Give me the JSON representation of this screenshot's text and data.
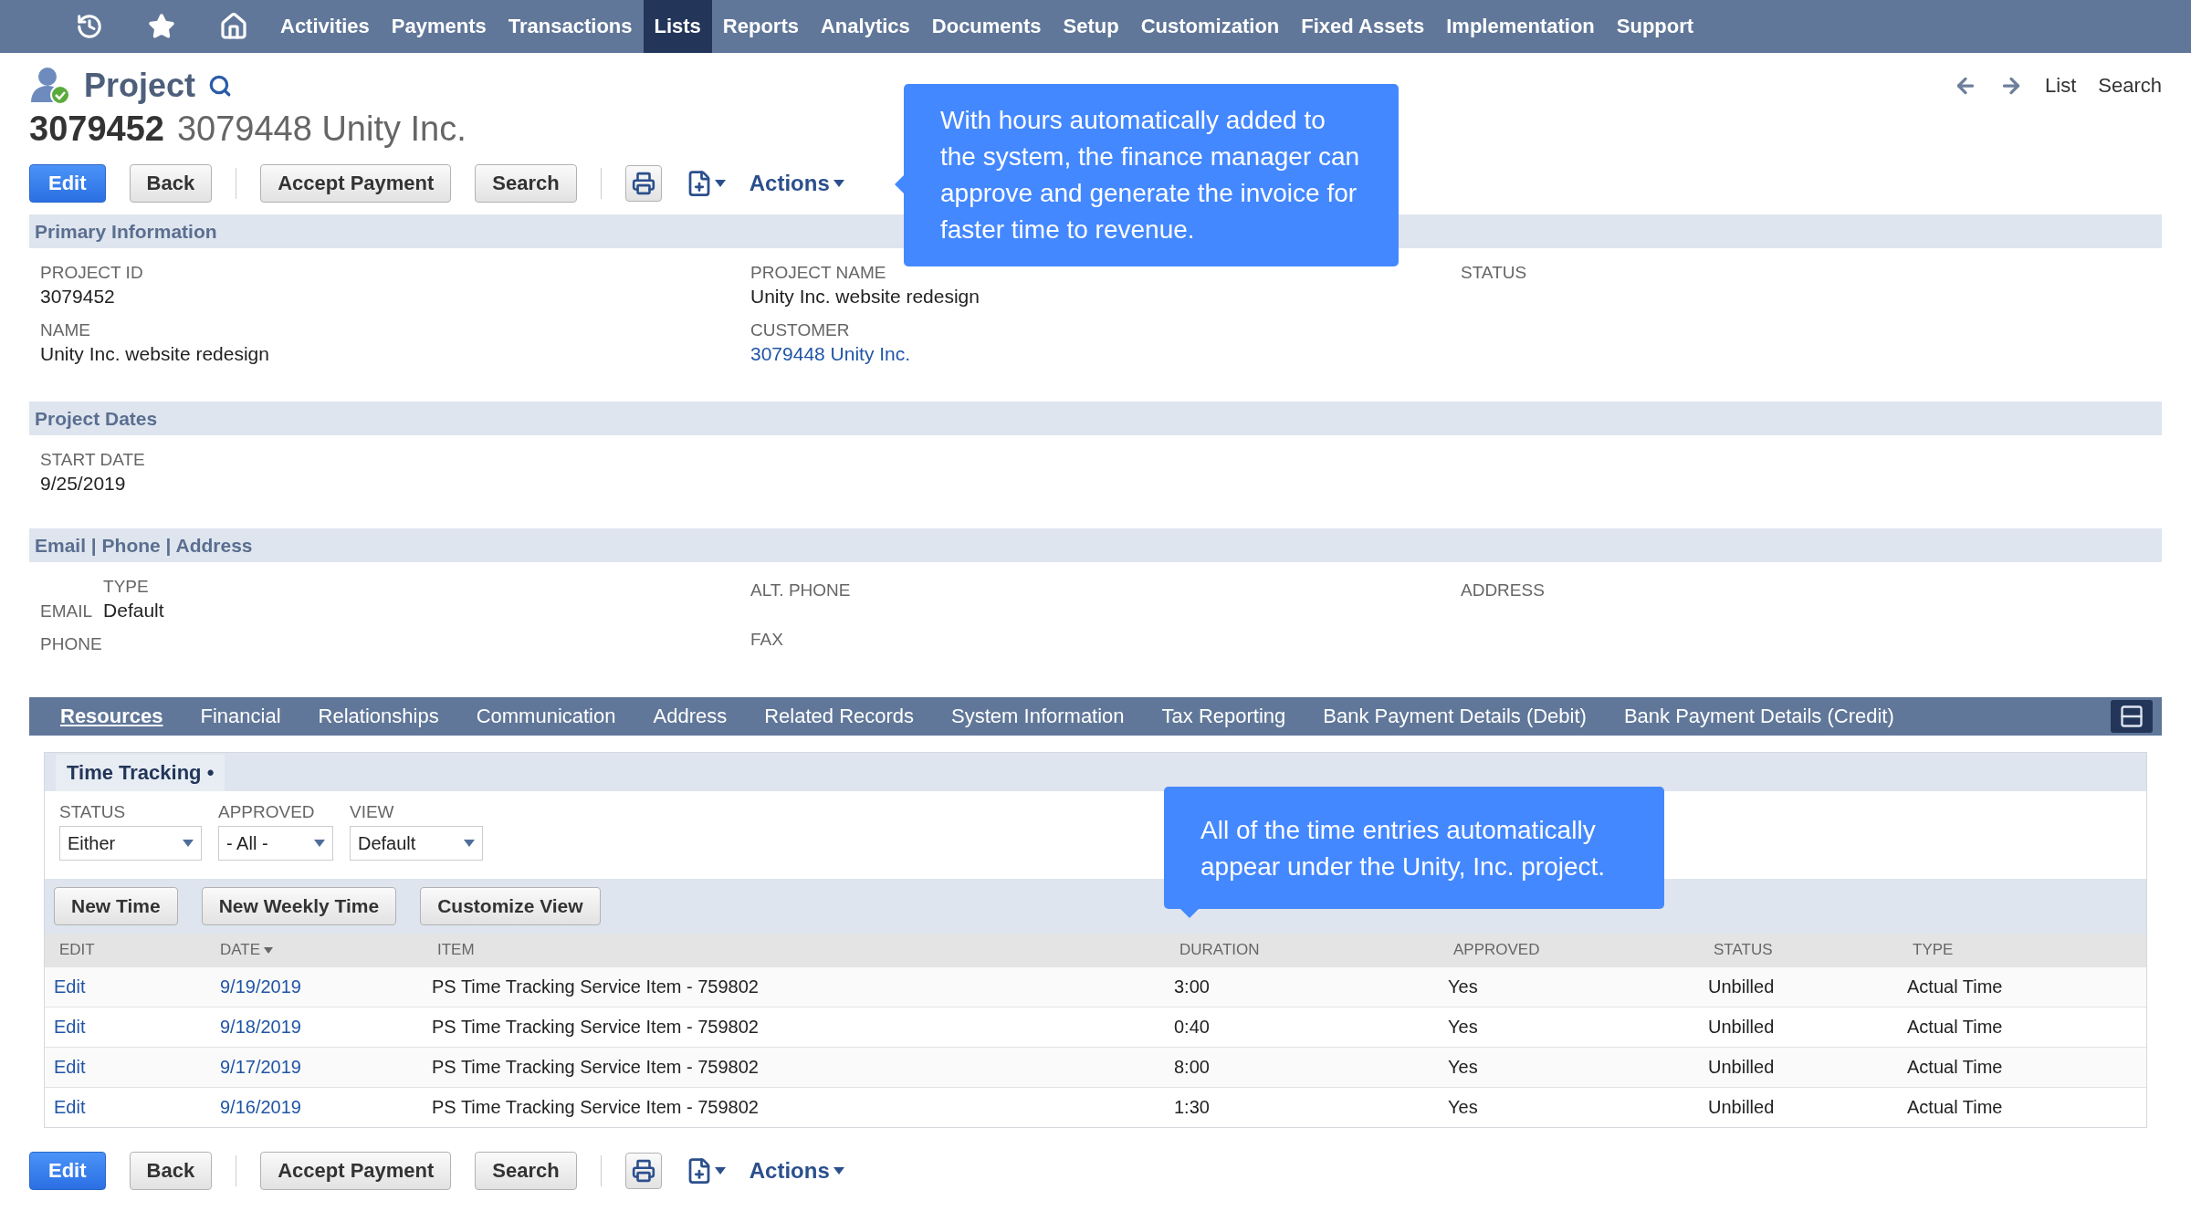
{
  "nav": {
    "items": [
      {
        "label": "Activities",
        "selected": false
      },
      {
        "label": "Payments",
        "selected": false
      },
      {
        "label": "Transactions",
        "selected": false
      },
      {
        "label": "Lists",
        "selected": true
      },
      {
        "label": "Reports",
        "selected": false
      },
      {
        "label": "Analytics",
        "selected": false
      },
      {
        "label": "Documents",
        "selected": false
      },
      {
        "label": "Setup",
        "selected": false
      },
      {
        "label": "Customization",
        "selected": false
      },
      {
        "label": "Fixed Assets",
        "selected": false
      },
      {
        "label": "Implementation",
        "selected": false
      },
      {
        "label": "Support",
        "selected": false
      }
    ]
  },
  "record": {
    "type": "Project",
    "id": "3079452",
    "name": "3079448 Unity Inc."
  },
  "header_links": [
    "List",
    "Search"
  ],
  "toolbar_top": {
    "button_groups": [
      [
        {
          "label": "Edit",
          "kind": "primary"
        },
        {
          "label": "Back",
          "kind": "secondary"
        }
      ],
      [
        {
          "label": "Accept Payment",
          "kind": "secondary"
        },
        {
          "label": "Search",
          "kind": "secondary"
        }
      ]
    ],
    "actions": "Actions"
  },
  "sections": [
    {
      "title": "Primary Information",
      "columns": [
        [
          {
            "label": "PROJECT ID",
            "value": "3079452",
            "kind": "text"
          },
          {
            "label": "NAME",
            "value": "Unity Inc. website redesign",
            "kind": "text"
          }
        ],
        [
          {
            "label": "PROJECT NAME",
            "value": "Unity Inc. website redesign",
            "kind": "text"
          },
          {
            "label": "CUSTOMER",
            "value": "3079448 Unity Inc.",
            "kind": "link"
          }
        ],
        [
          {
            "label": "STATUS",
            "kind": "text"
          }
        ]
      ]
    },
    {
      "title": "Project Dates",
      "columns": [
        [
          {
            "label": "START DATE",
            "value": "9/25/2019",
            "kind": "text"
          }
        ],
        [],
        []
      ]
    },
    {
      "title": "Email | Phone | Address",
      "columns": [
        [
          {
            "label": "EMAIL",
            "type_label": "TYPE",
            "value": "Default",
            "kind": "typed"
          },
          {
            "label": "PHONE",
            "kind": "text"
          }
        ],
        [
          {
            "label": "ALT. PHONE",
            "kind": "spaced"
          },
          {
            "label": "FAX",
            "kind": "spaced"
          }
        ],
        [
          {
            "label": "ADDRESS",
            "kind": "spaced"
          }
        ]
      ]
    }
  ],
  "subtabs": [
    {
      "label": "Resources",
      "selected": true
    },
    {
      "label": "Financial",
      "selected": false
    },
    {
      "label": "Relationships",
      "selected": false
    },
    {
      "label": "Communication",
      "selected": false
    },
    {
      "label": "Address",
      "selected": false
    },
    {
      "label": "Related Records",
      "selected": false
    },
    {
      "label": "System Information",
      "selected": false
    },
    {
      "label": "Tax Reporting",
      "selected": false
    },
    {
      "label": "Bank Payment Details (Debit)",
      "selected": false
    },
    {
      "label": "Bank Payment Details (Credit)",
      "selected": false
    }
  ],
  "time_tracking": {
    "title": "Time Tracking •",
    "filters": [
      {
        "label": "STATUS",
        "value": "Either"
      },
      {
        "label": "APPROVED",
        "value": "- All -"
      },
      {
        "label": "VIEW",
        "value": "Default"
      }
    ],
    "buttons": [
      "New Time",
      "New Weekly Time",
      "Customize View"
    ],
    "columns": [
      {
        "label": "EDIT",
        "sorted": false
      },
      {
        "label": "DATE",
        "sorted": true
      },
      {
        "label": "ITEM",
        "sorted": false
      },
      {
        "label": "DURATION",
        "sorted": false
      },
      {
        "label": "APPROVED",
        "sorted": false
      },
      {
        "label": "STATUS",
        "sorted": false
      },
      {
        "label": "TYPE",
        "sorted": false
      }
    ],
    "rows": [
      {
        "edit": "Edit",
        "date": "9/19/2019",
        "item": "PS Time Tracking Service Item - 759802",
        "duration": "3:00",
        "approved": "Yes",
        "status": "Unbilled",
        "type": "Actual Time"
      },
      {
        "edit": "Edit",
        "date": "9/18/2019",
        "item": "PS Time Tracking Service Item - 759802",
        "duration": "0:40",
        "approved": "Yes",
        "status": "Unbilled",
        "type": "Actual Time"
      },
      {
        "edit": "Edit",
        "date": "9/17/2019",
        "item": "PS Time Tracking Service Item - 759802",
        "duration": "8:00",
        "approved": "Yes",
        "status": "Unbilled",
        "type": "Actual Time"
      },
      {
        "edit": "Edit",
        "date": "9/16/2019",
        "item": "PS Time Tracking Service Item - 759802",
        "duration": "1:30",
        "approved": "Yes",
        "status": "Unbilled",
        "type": "Actual Time"
      }
    ]
  },
  "toolbar_bottom": {
    "button_groups": [
      [
        {
          "label": "Edit",
          "kind": "primary"
        },
        {
          "label": "Back",
          "kind": "secondary"
        }
      ],
      [
        {
          "label": "Accept Payment",
          "kind": "secondary"
        },
        {
          "label": "Search",
          "kind": "secondary"
        }
      ]
    ],
    "actions": "Actions"
  },
  "callouts": [
    "With hours automatically added to the system, the finance manager can approve and generate the invoice for faster time to revenue.",
    "All of the time entries automatically appear under the Unity, Inc. project."
  ]
}
